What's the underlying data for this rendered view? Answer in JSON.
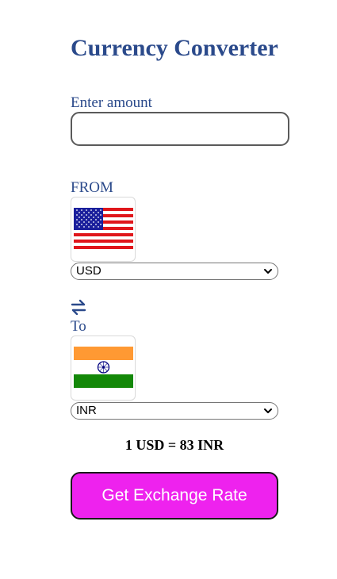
{
  "title": "Currency Converter",
  "amount": {
    "label": "Enter amount",
    "value": "",
    "placeholder": ""
  },
  "from": {
    "label": "FROM",
    "flag_icon": "us-flag-icon",
    "selected": "USD"
  },
  "to": {
    "label": "To",
    "flag_icon": "india-flag-icon",
    "selected": "INR"
  },
  "swap_icon": "swap-arrows-icon",
  "rate_text": "1 USD = 83 INR",
  "button_label": "Get Exchange Rate",
  "colors": {
    "title": "#2b4a8b",
    "button": "#ee22ee",
    "button_text": "#ffffff"
  }
}
